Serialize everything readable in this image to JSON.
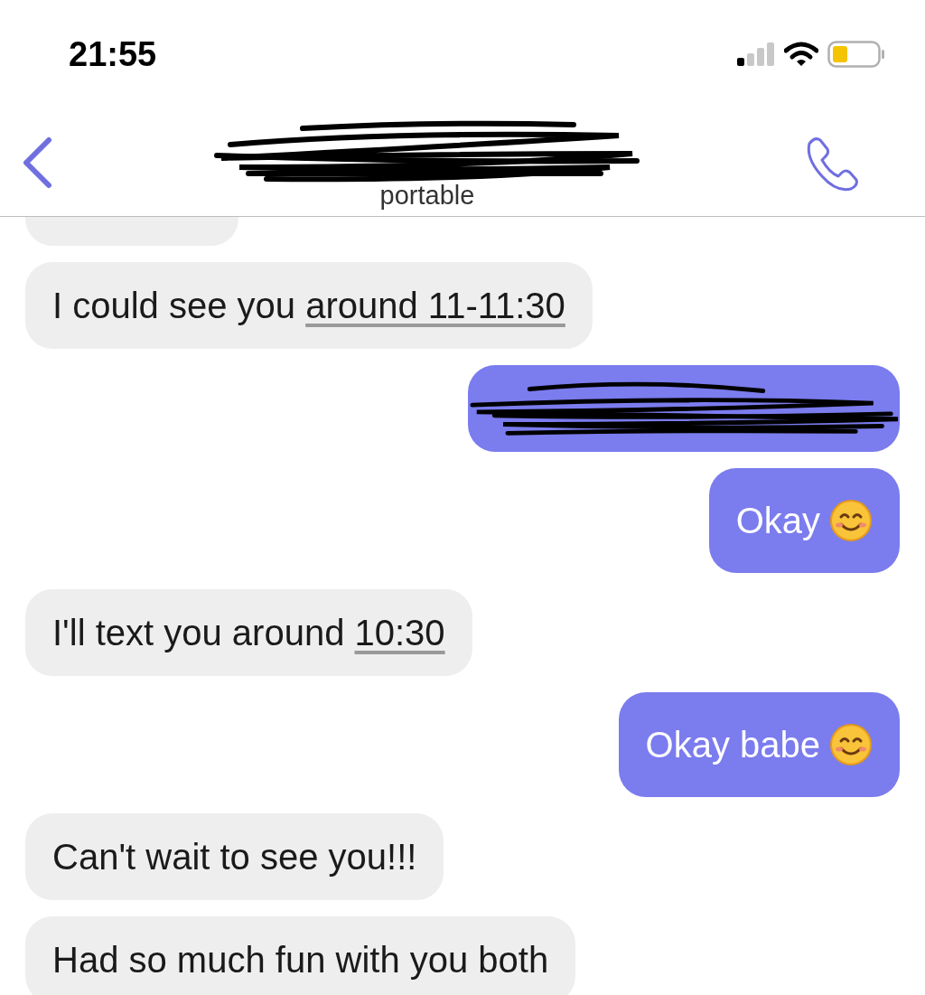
{
  "status_bar": {
    "time": "21:55"
  },
  "header": {
    "subtitle": "portable"
  },
  "messages": [
    {
      "kind": "cut"
    },
    {
      "kind": "incoming",
      "text": "I could see you ",
      "link": "around 11-11:30",
      "emoji": false
    },
    {
      "kind": "redacted"
    },
    {
      "kind": "outgoing",
      "text": "Okay",
      "emoji": true
    },
    {
      "kind": "incoming",
      "text": "I'll text you around ",
      "link": "10:30",
      "emoji": false
    },
    {
      "kind": "outgoing",
      "text": "Okay babe",
      "emoji": true
    },
    {
      "kind": "incoming",
      "text": "Can't wait to see you!!!",
      "emoji": false
    },
    {
      "kind": "incoming",
      "text": "Had so much fun with you both",
      "emoji": false
    }
  ]
}
